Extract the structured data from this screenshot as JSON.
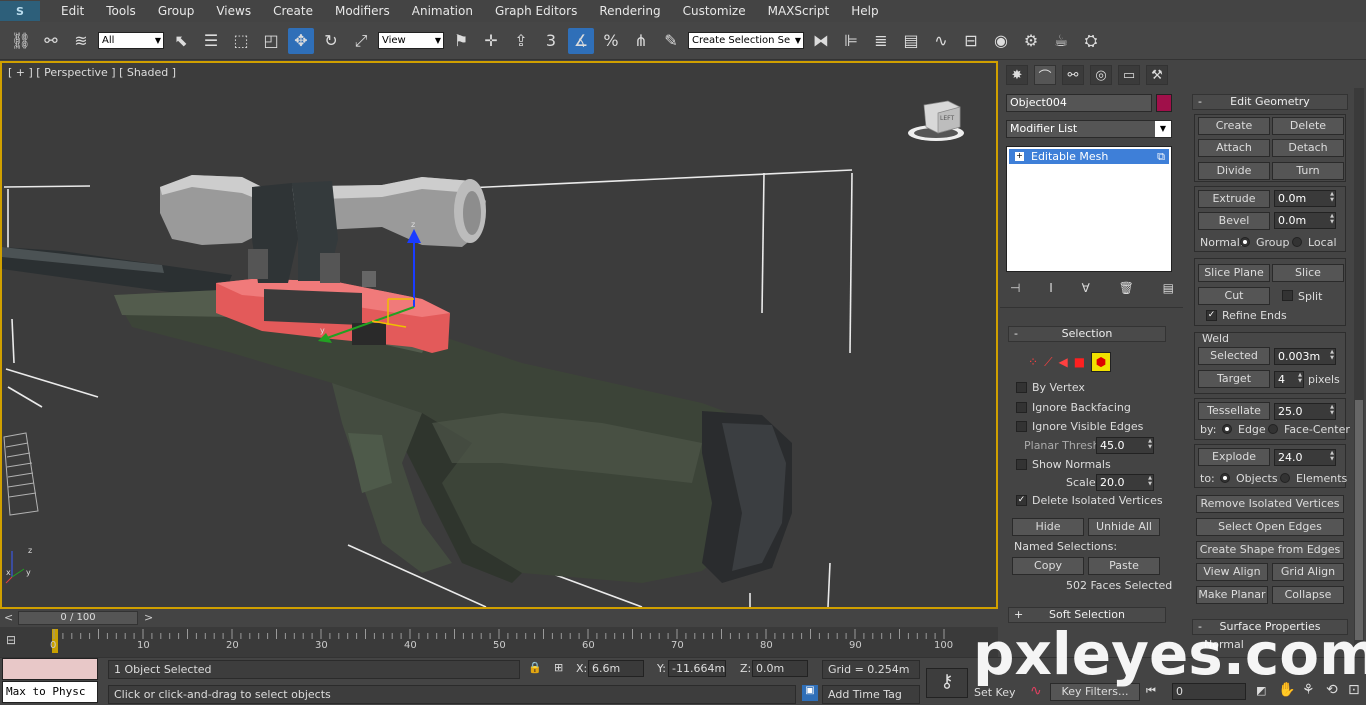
{
  "menubar": {
    "items": [
      "Edit",
      "Tools",
      "Group",
      "Views",
      "Create",
      "Modifiers",
      "Animation",
      "Graph Editors",
      "Rendering",
      "Customize",
      "MAXScript",
      "Help"
    ]
  },
  "toolbar": {
    "filter_select": "All",
    "ref_coord_select": "View",
    "angle_snap": "3",
    "named_selection_placeholder": "Create Selection Se"
  },
  "viewport": {
    "label": "[ + ] [ Perspective ] [ Shaded ]",
    "viewcube_face": "LEFT"
  },
  "command_panel": {
    "object_name": "Object004",
    "object_color": "#a0104a",
    "modifier_list": "Modifier List",
    "stack_item": "Editable Mesh",
    "selection": {
      "title": "Selection",
      "by_vertex": "By Vertex",
      "ignore_backfacing": "Ignore Backfacing",
      "ignore_visible_edges": "Ignore Visible Edges",
      "planar_thresh_label": "Planar Thresh:",
      "planar_thresh": "45.0",
      "show_normals": "Show Normals",
      "scale_label": "Scale:",
      "scale": "20.0",
      "delete_isolated": "Delete Isolated Vertices",
      "hide": "Hide",
      "unhide_all": "Unhide All",
      "named_selections": "Named Selections:",
      "copy": "Copy",
      "paste": "Paste",
      "status": "502 Faces Selected"
    },
    "soft_selection": "Soft Selection"
  },
  "edit_geometry": {
    "title": "Edit Geometry",
    "create": "Create",
    "delete": "Delete",
    "attach": "Attach",
    "detach": "Detach",
    "divide": "Divide",
    "turn": "Turn",
    "extrude": "Extrude",
    "extrude_val": "0.0m",
    "bevel": "Bevel",
    "bevel_val": "0.0m",
    "normal_label": "Normal:",
    "group": "Group",
    "local": "Local",
    "slice_plane": "Slice Plane",
    "slice": "Slice",
    "cut": "Cut",
    "split": "Split",
    "refine_ends": "Refine Ends",
    "weld": "Weld",
    "selected": "Selected",
    "selected_val": "0.003m",
    "target": "Target",
    "target_val": "4",
    "pixels": "pixels",
    "tessellate": "Tessellate",
    "tessellate_val": "25.0",
    "by_label": "by:",
    "edge": "Edge",
    "face_center": "Face-Center",
    "explode": "Explode",
    "explode_val": "24.0",
    "to_label": "to:",
    "objects": "Objects",
    "elements": "Elements",
    "remove_isolated": "Remove Isolated Vertices",
    "select_open_edges": "Select Open Edges",
    "create_shape": "Create Shape from Edges",
    "view_align": "View Align",
    "grid_align": "Grid Align",
    "make_planar": "Make Planar",
    "collapse": "Collapse",
    "surface_properties": "Surface Properties",
    "normals_partial": "Normal"
  },
  "timeline": {
    "frame": "0 / 100",
    "ticks": [
      "0",
      "10",
      "20",
      "30",
      "40",
      "50",
      "60",
      "70",
      "80",
      "90",
      "100"
    ]
  },
  "status": {
    "selected": "1 Object Selected",
    "prompt": "Click or click-and-drag to select objects",
    "maxscript": "Max to Physc",
    "x_label": "X:",
    "x": "6.6m",
    "y_label": "Y:",
    "y": "-11.664m",
    "z_label": "Z:",
    "z": "0.0m",
    "grid": "Grid = 0.254m",
    "add_time_tag": "Add Time Tag",
    "set_key": "Set Key",
    "key_filters": "Key Filters...",
    "frame_val": "0"
  },
  "watermark": "pxleyes.com"
}
